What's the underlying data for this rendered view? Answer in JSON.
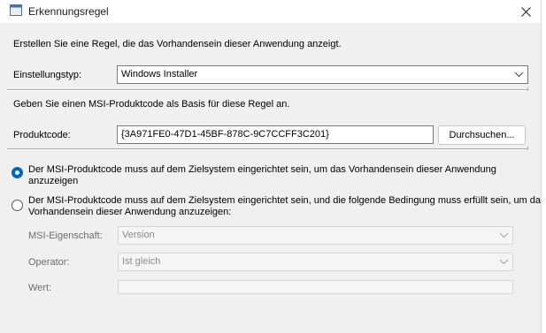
{
  "window": {
    "title": "Erkennungsregel",
    "close_icon": "close-icon",
    "app_icon": "window-icon"
  },
  "intro": "Erstellen Sie eine Regel, die das Vorhandensein dieser Anwendung anzeigt.",
  "rule_type": {
    "label": "Einstellungstyp:",
    "value": "Windows Installer"
  },
  "msi_hint": "Geben Sie einen MSI-Produktcode als Basis für diese Regel an.",
  "product_code": {
    "label": "Produktcode:",
    "value": "{3A971FE0-47D1-45BF-878C-9C7CCFF3C201}",
    "browse_label": "Durchsuchen..."
  },
  "options": [
    {
      "line1": "Der MSI-Produktcode muss auf dem Zielsystem eingerichtet sein, um das Vorhandensein dieser Anwendung",
      "line2": "anzuzeigen",
      "selected": true
    },
    {
      "line1": "Der MSI-Produktcode muss auf dem Zielsystem eingerichtet sein, und die folgende Bedingung muss erfüllt sein, um das",
      "line2": "Vorhandensein dieser Anwendung anzuzeigen:",
      "selected": false
    }
  ],
  "condition": {
    "property_label": "MSI-Eigenschaft:",
    "property_value": "Version",
    "operator_label": "Operator:",
    "operator_value": "Ist gleich",
    "value_label": "Wert:",
    "value_value": ""
  },
  "colors": {
    "accent": "#0067c0",
    "background": "#f0f0f0"
  }
}
